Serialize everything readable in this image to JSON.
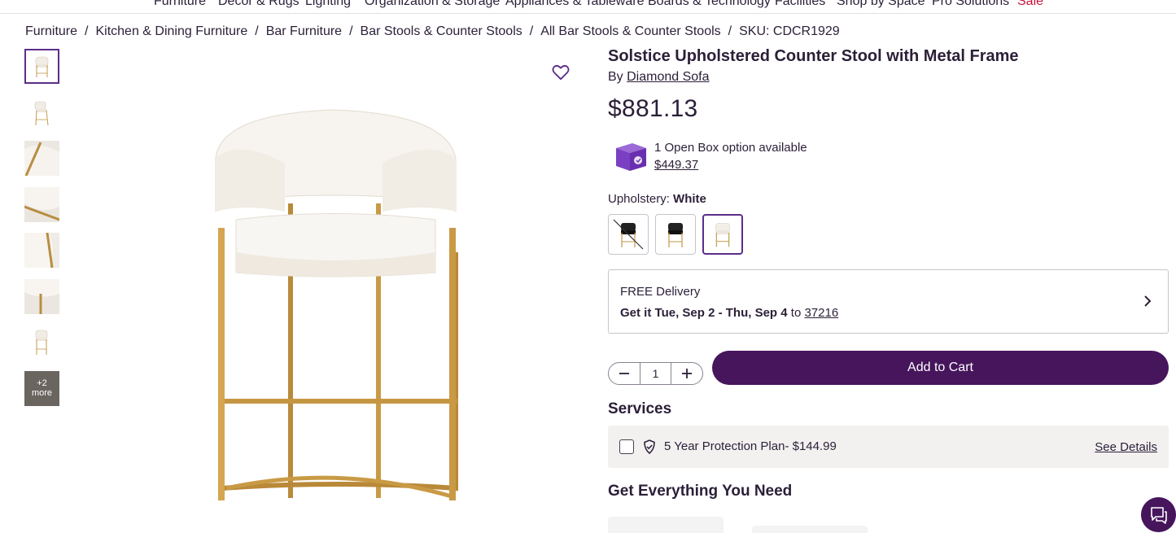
{
  "topnav": {
    "items": [
      "Furniture",
      "Decor & Rugs",
      "Lighting",
      "Organization & Storage",
      "Appliances & Tableware",
      "Boards & Technology",
      "Facilities",
      "Shop by Space",
      "Pro Solutions",
      "Sale"
    ]
  },
  "breadcrumb": {
    "items": [
      "Furniture",
      "Kitchen & Dining Furniture",
      "Bar Furniture",
      "Bar Stools & Counter Stools",
      "All Bar Stools & Counter Stools"
    ],
    "separator": "/",
    "sku": "SKU: CDCR1929"
  },
  "gallery": {
    "more_count": "+2",
    "more_label": "more"
  },
  "product": {
    "title": "Solstice Upholstered Counter Stool with Metal Frame",
    "by_prefix": "By",
    "brand": "Diamond Sofa",
    "price": "$881.13",
    "open_box_text": "1 Open Box option available",
    "open_box_price": "$449.37",
    "upholstery_label": "Upholstery:",
    "upholstery_value": "White",
    "swatches": [
      "Black (unavailable)",
      "Black",
      "White"
    ],
    "selected_swatch": 2
  },
  "delivery": {
    "line1": "FREE Delivery",
    "prefix": "Get it",
    "dates": "Tue, Sep 2 - Thu, Sep 4",
    "to": "to",
    "zip": "37216"
  },
  "cart": {
    "quantity": "1",
    "add_label": "Add to Cart"
  },
  "services": {
    "heading": "Services",
    "plan": "5 Year Protection Plan- $144.99",
    "see_details": "See Details"
  },
  "recommendations": {
    "heading": "Get Everything You Need"
  },
  "colors": {
    "brand_purple": "#46155c",
    "selected_border": "#5c2d8a",
    "text": "#2b1f38",
    "sale": "#c9143d"
  },
  "icons": [
    "heart-icon",
    "open-box-icon",
    "chevron-right-icon",
    "minus-icon",
    "plus-icon",
    "shield-check-icon",
    "chat-icon"
  ]
}
